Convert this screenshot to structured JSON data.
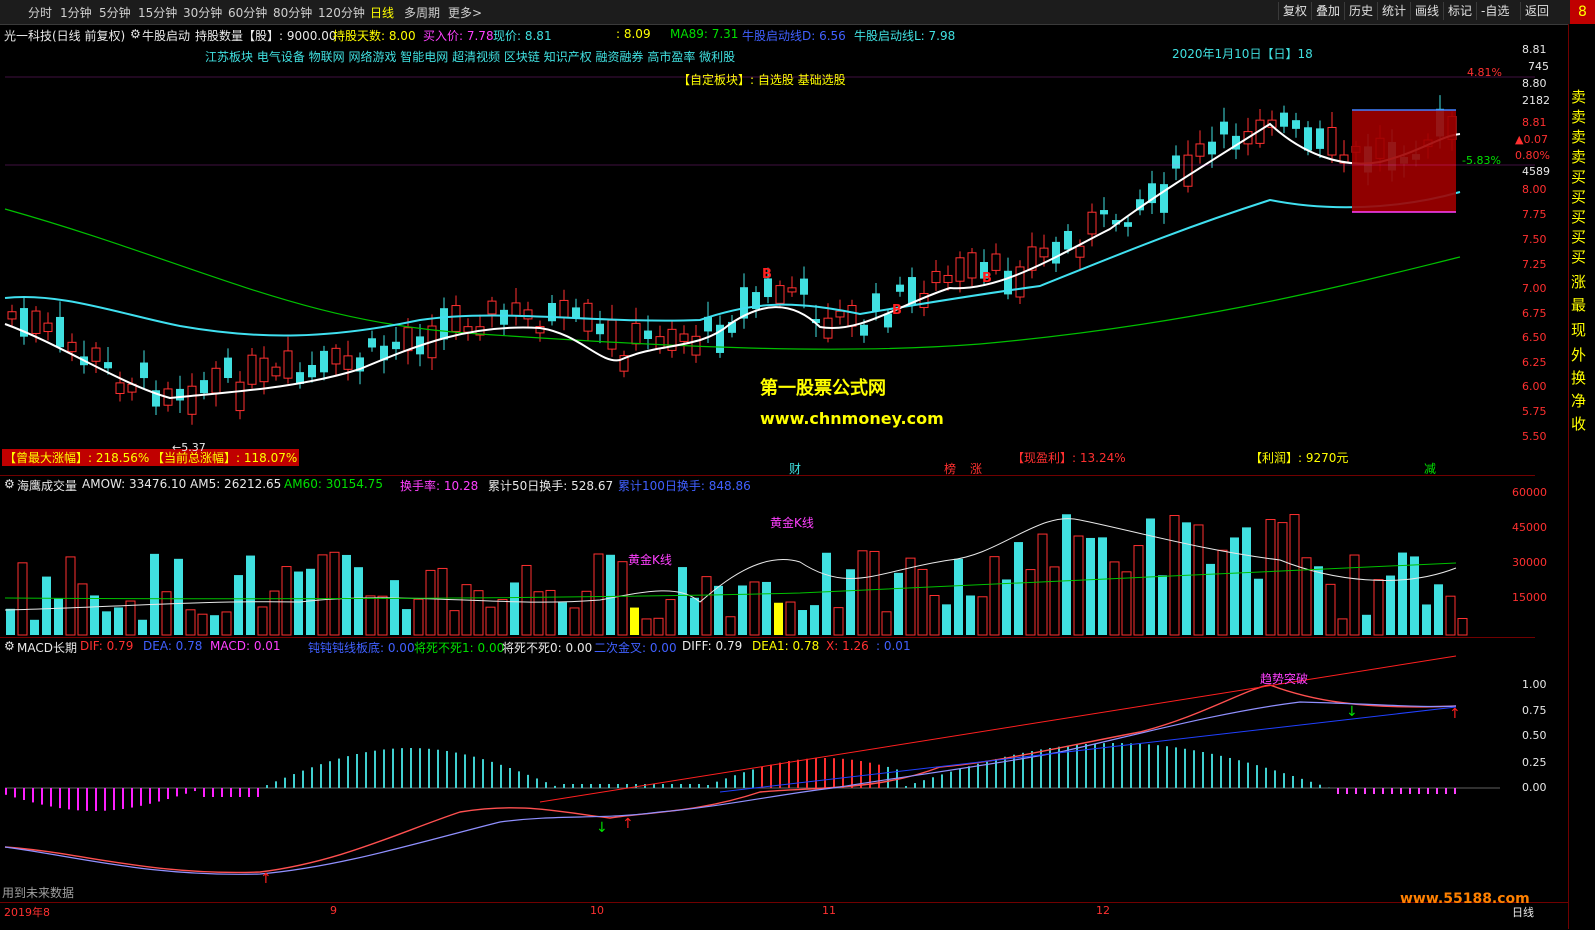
{
  "toolbar": {
    "timeframes": [
      "分时",
      "1分钟",
      "5分钟",
      "15分钟",
      "30分钟",
      "60分钟",
      "80分钟",
      "120分钟",
      "日线",
      "多周期",
      "更多>"
    ],
    "active_timeframe": "日线",
    "buttons": [
      "复权",
      "叠加",
      "历史",
      "统计",
      "画线",
      "标记",
      "-自选",
      "返回"
    ],
    "corner": "8"
  },
  "main_header": {
    "stock": "光一科技(日线 前复权)",
    "indicator": "牛股启动",
    "hold_qty": "持股数量【股】: 9000.00",
    "hold_days": "持股天数: 8.00",
    "buy_price": "买入价: 7.78",
    "cur_price": "现价: 8.81",
    "val_809": ": 8.09",
    "ma89": "MA89: 7.31",
    "niu_d": "牛股启动线D: 6.56",
    "niu_l": "牛股启动线L: 7.98"
  },
  "concepts": "江苏板块 电气设备 物联网 网络游戏 智能电网 超清视频 区块链 知识产权 融资融券 高市盈率 微利股",
  "custom_block": "【自定板块】: 自选股 基础选股",
  "date_label": "2020年1月10日【日】18",
  "max_gain": "【曾最大涨幅】: 218.56%",
  "cur_gain": "【当前总涨幅】: 118.07%",
  "profit_rate": "【现盈利】: 13.24%",
  "profit": "【利润】: 9270元",
  "markers": {
    "cai": "财",
    "bang": "榜",
    "zhang": "涨",
    "jian": "减",
    "low_label": "←5.37"
  },
  "watermark": {
    "line1": "第一股票公式网",
    "line2": "www.chnmoney.com",
    "bottom": "www.55188.com"
  },
  "price_axis": [
    "8.81",
    "745",
    "8.80",
    "2182",
    "8.81",
    "▲0.07",
    "0.80%",
    "4589",
    "8.00",
    "7.75",
    "7.50",
    "7.25",
    "7.00",
    "6.75",
    "6.50",
    "6.25",
    "6.00",
    "5.75",
    "5.50"
  ],
  "pct_labels": {
    "top": "4.81%",
    "mid": "-5.83%"
  },
  "volume_header": {
    "name": "海鹰成交量",
    "amow": "AMOW: 33476.10",
    "am5": "AM5: 26212.65",
    "am60": "AM60: 30154.75",
    "turnover": "换手率: 10.28",
    "turn50": "累计50日换手: 528.67",
    "turn100": "累计100日换手: 848.86"
  },
  "volume_axis": [
    "60000",
    "45000",
    "30000",
    "15000"
  ],
  "golden_k": "黄金K线",
  "macd_header": {
    "name": "MACD长期",
    "dif": "DIF: 0.79",
    "dea": "DEA: 0.78",
    "macd": "MACD: 0.01",
    "jjj": "钝钝钝线板底: 0.00",
    "jsbs1": "将死不死1: 0.00",
    "jsbs0": "将死不死0: 0.00",
    "ecjc": "二次金叉: 0.00",
    "diff": "DIFF: 0.79",
    "dea1": "DEA1: 0.78",
    "x": "X: 1.26",
    "extra": ": 0.01"
  },
  "macd_axis": [
    "1.00",
    "0.75",
    "0.50",
    "0.25",
    "0.00"
  ],
  "trend_break": "趋势突破",
  "future_data": "用到未来数据",
  "x_axis": [
    "2019年8",
    "9",
    "10",
    "11",
    "12"
  ],
  "period_label": "日线",
  "right_panel": [
    "卖",
    "卖",
    "卖",
    "卖",
    "买",
    "买",
    "买",
    "买",
    "买",
    "涨",
    "最",
    "现",
    "外",
    "换",
    "净",
    "收"
  ],
  "colors": {
    "up": "#ff3030",
    "down": "#40e0e0",
    "ma_white": "#ffffff",
    "ma_cyan": "#40e0f0",
    "ma_green": "#00c000"
  }
}
